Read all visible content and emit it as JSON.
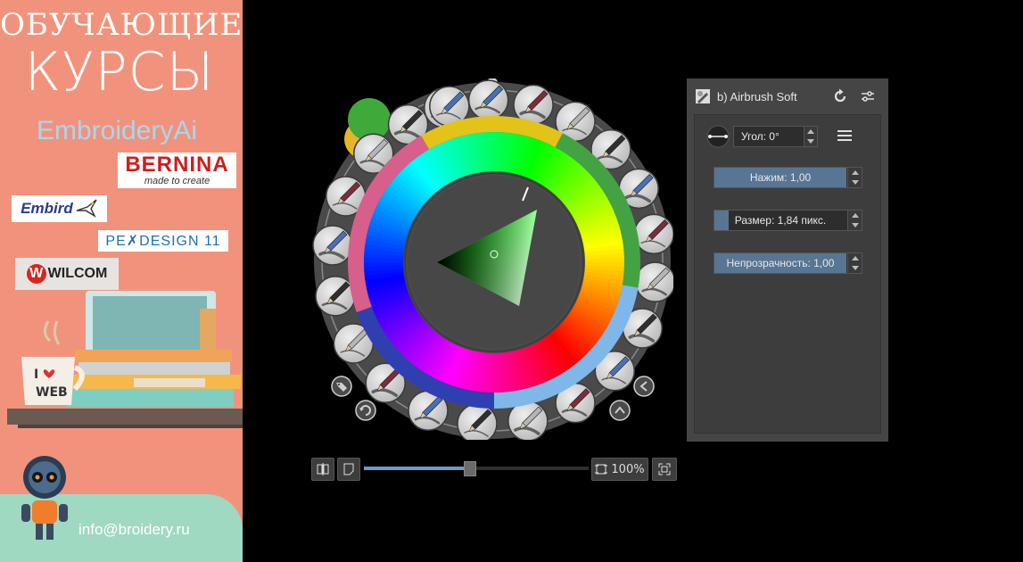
{
  "banner": {
    "line1": "ОБУЧАЮЩИЕ",
    "line2": "КУРСЫ",
    "line3": "EmbroideryAi",
    "logos": {
      "bernina": "BERNINA",
      "bernina_tag": "made to create",
      "embird": "Embird",
      "pe_design": "PE✗DESIGN 11",
      "wilcom": "WILCOM"
    },
    "mug_text_top": "I",
    "mug_text_bottom": "WEB",
    "email": "info@broidery.ru"
  },
  "zoom": {
    "level": "100%",
    "slider_fraction": 0.47
  },
  "brush_panel": {
    "title": "b) Airbrush Soft",
    "angle_label": "Угол: 0°",
    "pressure": {
      "label": "Нажим: 1,00",
      "fraction": 1.0
    },
    "size": {
      "label": "Размер: 1,84 пикс.",
      "fraction": 0.11
    },
    "opacity": {
      "label": "Непрозрачность: 1,00",
      "fraction": 1.0
    }
  },
  "colors": {
    "foreground": "#3fa93a",
    "background": "#e2b72a",
    "selected_hue": "#00ff00",
    "accent": "#587593"
  },
  "icons": {
    "refresh": "refresh-icon",
    "settings": "sliders-icon",
    "menu": "hamburger-icon",
    "tag": "tag-icon",
    "rotate": "rotate-icon",
    "chevron_up": "chevron-up-icon",
    "chevron_left": "chevron-left-icon"
  }
}
